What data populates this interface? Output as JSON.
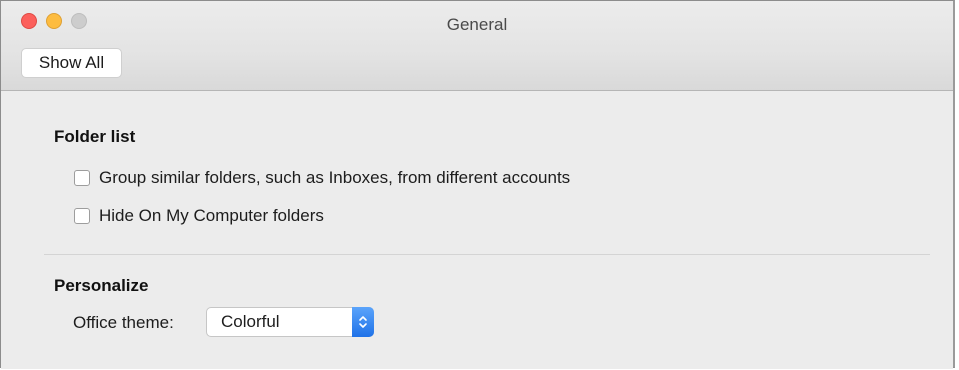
{
  "window": {
    "title": "General"
  },
  "toolbar": {
    "show_all_label": "Show All"
  },
  "folder_list": {
    "heading": "Folder list",
    "options": [
      {
        "label": "Group similar folders, such as Inboxes, from different accounts",
        "checked": false
      },
      {
        "label": "Hide On My Computer folders",
        "checked": false
      }
    ]
  },
  "personalize": {
    "heading": "Personalize",
    "theme_label": "Office theme:",
    "theme_value": "Colorful"
  },
  "colors": {
    "close": "#fc605c",
    "minimize": "#fdbc40",
    "zoom": "#cdcdcd",
    "select_accent": "#1f72e8"
  }
}
